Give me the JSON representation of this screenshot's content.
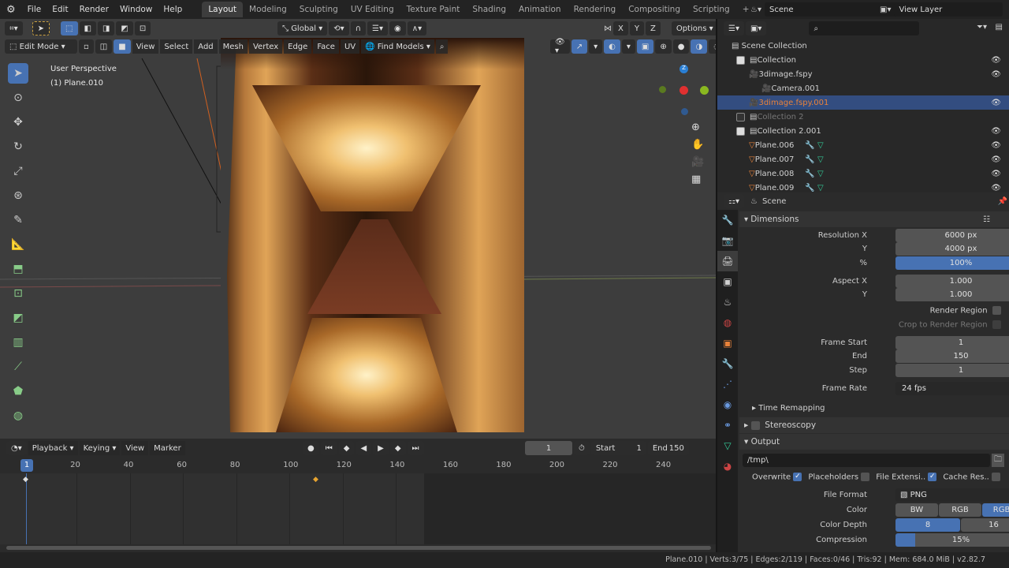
{
  "topbar": {
    "menus": [
      "File",
      "Edit",
      "Render",
      "Window",
      "Help"
    ],
    "workspaces": [
      "Layout",
      "Modeling",
      "Sculpting",
      "UV Editing",
      "Texture Paint",
      "Shading",
      "Animation",
      "Rendering",
      "Compositing",
      "Scripting"
    ],
    "active_workspace": "Layout",
    "add_tab": "+",
    "scene": "Scene",
    "view_layer": "View Layer"
  },
  "viewport": {
    "transform_orientation": "Global",
    "axes": [
      "X",
      "Y",
      "Z"
    ],
    "options": "Options",
    "mode": "Edit Mode",
    "menus": [
      "View",
      "Select",
      "Add",
      "Mesh",
      "Vertex",
      "Edge",
      "Face",
      "UV"
    ],
    "find_models": "Find Models",
    "overlay_title": "User Perspective",
    "overlay_object": "(1) Plane.010"
  },
  "outliner": {
    "root": "Scene Collection",
    "items": [
      {
        "name": "Collection",
        "type": "collection",
        "checked": true
      },
      {
        "name": "3dimage.fspy",
        "type": "fspy"
      },
      {
        "name": "Camera.001",
        "type": "camera"
      },
      {
        "name": "3dimage.fspy.001",
        "type": "fspy",
        "selected": true
      },
      {
        "name": "Collection 2",
        "type": "collection",
        "checked": false
      },
      {
        "name": "Collection 2.001",
        "type": "collection",
        "checked": true
      },
      {
        "name": "Plane.006",
        "type": "mesh"
      },
      {
        "name": "Plane.007",
        "type": "mesh"
      },
      {
        "name": "Plane.008",
        "type": "mesh"
      },
      {
        "name": "Plane.009",
        "type": "mesh"
      }
    ]
  },
  "properties": {
    "context": "Scene",
    "dimensions": {
      "title": "Dimensions",
      "resolution_x_label": "Resolution X",
      "resolution_x": "6000 px",
      "y_label": "Y",
      "resolution_y": "4000 px",
      "pct_label": "%",
      "percent": "100%",
      "aspect_x_label": "Aspect X",
      "aspect_x": "1.000",
      "aspect_y": "1.000",
      "render_region": "Render Region",
      "crop": "Crop to Render Region",
      "frame_start_label": "Frame Start",
      "frame_start": "1",
      "end_label": "End",
      "frame_end": "150",
      "step_label": "Step",
      "step": "1",
      "frame_rate_label": "Frame Rate",
      "frame_rate": "24 fps",
      "time_remapping": "Time Remapping"
    },
    "stereoscopy": "Stereoscopy",
    "output": {
      "title": "Output",
      "path": "/tmp\\",
      "overwrite": "Overwrite",
      "placeholders": "Placeholders",
      "file_ext": "File Extensi..",
      "cache": "Cache Res..",
      "file_format_label": "File Format",
      "file_format": "PNG",
      "color_label": "Color",
      "color_opts": [
        "BW",
        "RGB",
        "RGBA"
      ],
      "depth_label": "Color Depth",
      "depth_opts": [
        "8",
        "16"
      ],
      "compression_label": "Compression",
      "compression": "15%"
    }
  },
  "timeline": {
    "menus": [
      "Playback",
      "Keying",
      "View",
      "Marker"
    ],
    "current_frame": "1",
    "start_label": "Start",
    "start": "1",
    "end_label": "End",
    "end": "150",
    "ticks": [
      "20",
      "40",
      "60",
      "80",
      "100",
      "120",
      "140",
      "160",
      "180",
      "200",
      "220",
      "240"
    ],
    "playhead": "1"
  },
  "status": "Plane.010 | Verts:3/75 | Edges:2/119 | Faces:0/46 | Tris:92 | Mem: 684.0 MiB | v2.82.7",
  "colors": {
    "accent": "#4772b3",
    "selected_row": "#334d80",
    "active_object_text": "#e8823a"
  }
}
